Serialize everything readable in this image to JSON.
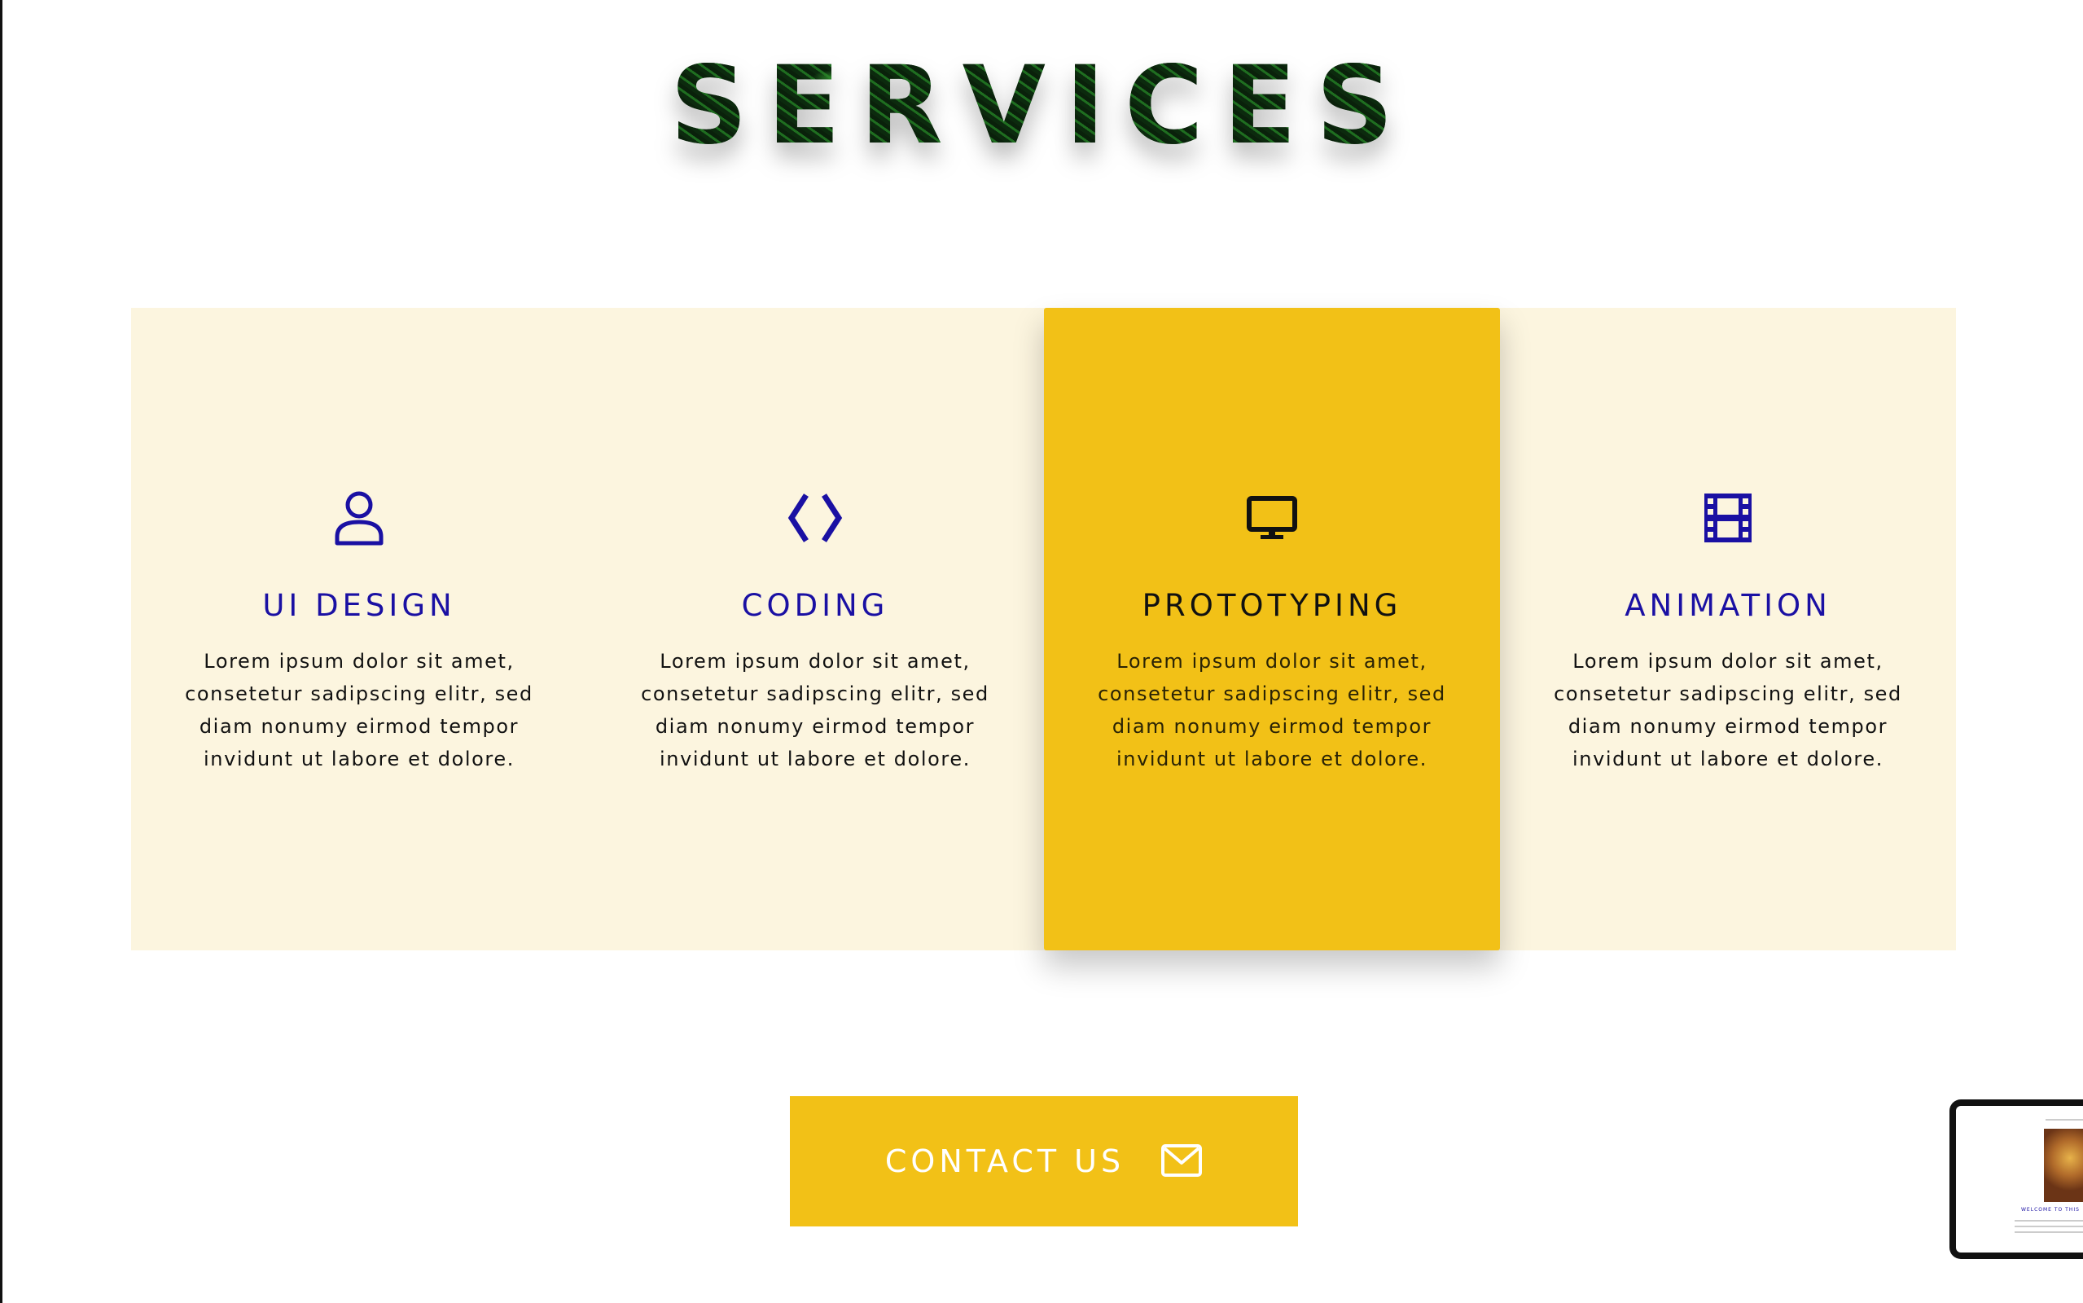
{
  "section": {
    "title": "SERVICES"
  },
  "services": [
    {
      "icon": "user-icon",
      "title": "UI DESIGN",
      "text": "Lorem ipsum dolor sit amet, consetetur sadipscing elitr, sed diam nonumy eirmod tempor invidunt ut labore et dolore."
    },
    {
      "icon": "code-brackets-icon",
      "title": "CODING",
      "text": "Lorem ipsum dolor sit amet, consetetur sadipscing elitr, sed diam nonumy eirmod tempor invidunt ut labore et dolore."
    },
    {
      "icon": "monitor-icon",
      "title": "PROTOTYPING",
      "text": "Lorem ipsum dolor sit amet, consetetur sadipscing elitr, sed diam nonumy eirmod tempor invidunt ut labore et dolore.",
      "highlighted": true
    },
    {
      "icon": "film-icon",
      "title": "ANIMATION",
      "text": "Lorem ipsum dolor sit amet, consetetur sadipscing elitr, sed diam nonumy eirmod tempor invidunt ut labore et dolore."
    }
  ],
  "contact": {
    "label": "CONTACT US",
    "icon": "envelope-icon"
  },
  "preview": {
    "heading": "WELCOME TO THIS"
  },
  "colors": {
    "accent_yellow": "#f2c117",
    "band_background": "#fcf5df",
    "title_blue": "#1a10a3",
    "text": "#111111"
  }
}
